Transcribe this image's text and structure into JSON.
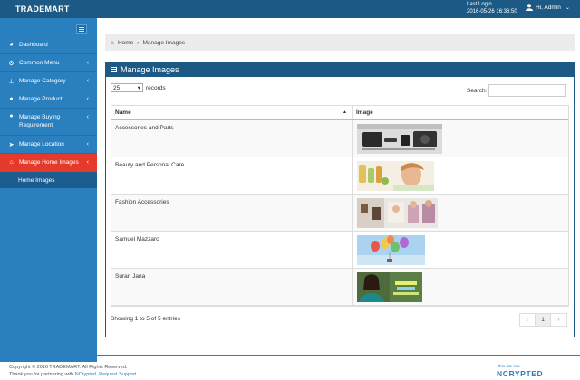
{
  "header": {
    "brand": "TRADEMART",
    "last_login_label": "Last Login",
    "last_login_time": "2016-05-26 16:36:50",
    "user_greeting": "Hi, Admin"
  },
  "sidebar": {
    "items": [
      {
        "label": "Dashboard",
        "icon": "dashboard-icon",
        "has_arrow": false
      },
      {
        "label": "Common Menu",
        "icon": "cogs-icon",
        "has_arrow": true
      },
      {
        "label": "Manage Category",
        "icon": "sitemap-icon",
        "has_arrow": true
      },
      {
        "label": "Manage Product",
        "icon": "user-icon",
        "has_arrow": true
      },
      {
        "label": "Manage Buying Requirement",
        "icon": "user-icon",
        "has_arrow": true
      },
      {
        "label": "Manage Location",
        "icon": "location-arrow-icon",
        "has_arrow": true
      },
      {
        "label": "Manage Home Images",
        "icon": "home-icon",
        "has_arrow": true,
        "active": true
      }
    ],
    "subitem": "Home Images",
    "active_color": "#e33a2c"
  },
  "breadcrumb": {
    "home": "Home",
    "current": "Manage Images"
  },
  "panel": {
    "title": "Manage Images",
    "length_value": "25",
    "records_label": "records",
    "search_label": "Search:",
    "columns": [
      "Name",
      "Image"
    ],
    "rows": [
      {
        "name": "Accessories and Parts",
        "image": "accessories-thumbnail"
      },
      {
        "name": "Beauty and Personal Care",
        "image": "beauty-thumbnail"
      },
      {
        "name": "Fashion Accessories",
        "image": "fashion-thumbnail"
      },
      {
        "name": "Samuel Mazzaro",
        "image": "balloons-thumbnail"
      },
      {
        "name": "Suran Jana",
        "image": "woman-portrait-thumbnail"
      }
    ],
    "info": "Showing 1 to 5 of 5 entries",
    "pager": {
      "prev": "‹",
      "page": "1",
      "next": "›"
    }
  },
  "footer": {
    "copyright": "Copyright © 2016 TRADEMART. All Rights Reserved.",
    "thanks_prefix": "Thank you for partnering with",
    "thanks_company": "NCrypted",
    "request_support": "Request Support",
    "logo_tagline": "this site is a",
    "logo_word": "NCRYPTED"
  },
  "colors": {
    "topbar": "#1c5a85",
    "sidebar": "#2a7fbf",
    "active": "#e33a2c"
  }
}
